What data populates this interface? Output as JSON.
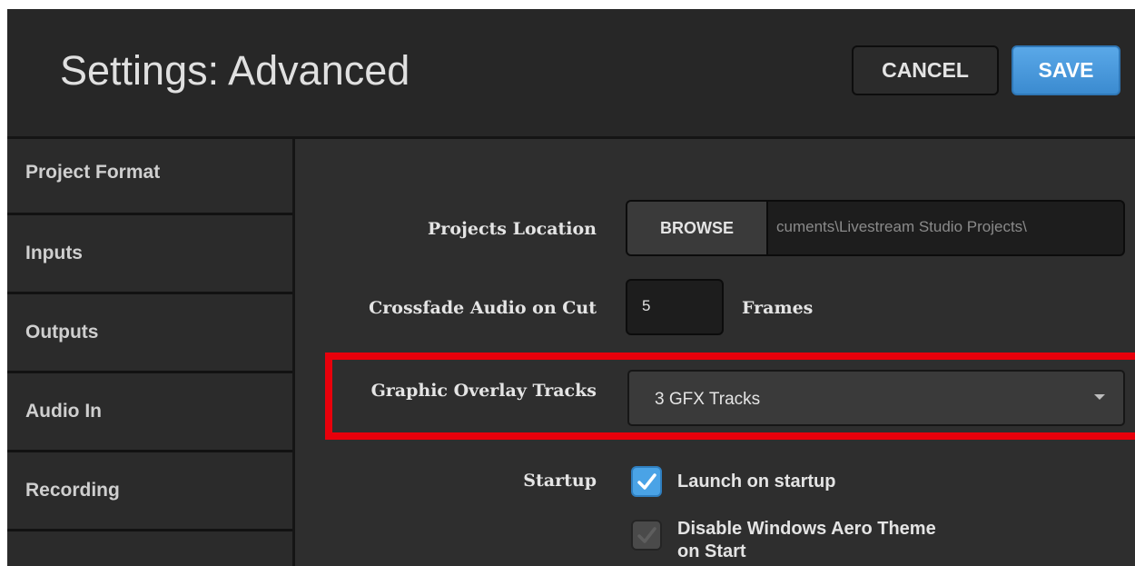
{
  "header": {
    "title": "Settings: Advanced",
    "cancel_label": "CANCEL",
    "save_label": "SAVE"
  },
  "sidebar": {
    "items": [
      {
        "label": "Project Format"
      },
      {
        "label": "Inputs"
      },
      {
        "label": "Outputs"
      },
      {
        "label": "Audio In"
      },
      {
        "label": "Recording"
      }
    ]
  },
  "settings": {
    "projects_location": {
      "label": "Projects Location",
      "browse_label": "BROWSE",
      "path": "cuments\\Livestream Studio Projects\\"
    },
    "crossfade": {
      "label": "Crossfade Audio on Cut",
      "value": "5",
      "unit": "Frames"
    },
    "graphic_overlay": {
      "label": "Graphic Overlay Tracks",
      "selected": "3 GFX Tracks"
    },
    "startup": {
      "label": "Startup",
      "launch_label": "Launch on startup",
      "launch_checked": true,
      "aero_label_line1": "Disable Windows Aero Theme",
      "aero_label_line2": "on Start",
      "aero_checked": false
    }
  },
  "colors": {
    "accent_blue": "#4aa3e6",
    "highlight_red": "#e8000b",
    "background": "#2e2e2e"
  }
}
